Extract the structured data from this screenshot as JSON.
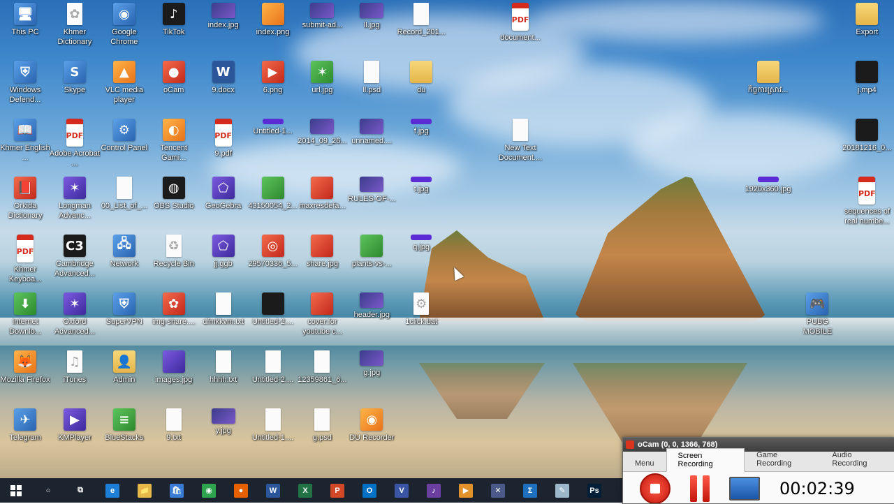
{
  "desktop": {
    "icons": [
      {
        "label": "This PC",
        "kind": "app",
        "glyph": "🖥"
      },
      {
        "label": "Khmer Dictionary",
        "kind": "file",
        "glyph": "✿"
      },
      {
        "label": "Google Chrome",
        "kind": "app",
        "glyph": "◉"
      },
      {
        "label": "TikTok",
        "kind": "dark",
        "glyph": "♪"
      },
      {
        "label": "index.jpg",
        "kind": "img",
        "glyph": ""
      },
      {
        "label": "index.png",
        "kind": "orange",
        "glyph": ""
      },
      {
        "label": "submit-ad...",
        "kind": "img",
        "glyph": ""
      },
      {
        "label": "ll.jpg",
        "kind": "img",
        "glyph": ""
      },
      {
        "label": "Record_201...",
        "kind": "file",
        "glyph": ""
      },
      {
        "label": "document...",
        "kind": "pdf",
        "glyph": "PDF"
      },
      {
        "label": "Export",
        "kind": "folder",
        "glyph": ""
      },
      {
        "label": "Windows Defend...",
        "kind": "app",
        "glyph": "⛨"
      },
      {
        "label": "Skype",
        "kind": "app",
        "glyph": "S"
      },
      {
        "label": "VLC media player",
        "kind": "orange",
        "glyph": "▲"
      },
      {
        "label": "oCam",
        "kind": "red",
        "glyph": "●"
      },
      {
        "label": "9.docx",
        "kind": "word",
        "glyph": "W"
      },
      {
        "label": "6.png",
        "kind": "red",
        "glyph": "▶"
      },
      {
        "label": "url.jpg",
        "kind": "green",
        "glyph": "✶"
      },
      {
        "label": "ll.psd",
        "kind": "file",
        "glyph": ""
      },
      {
        "label": "du",
        "kind": "folder",
        "glyph": ""
      },
      {
        "label": "កិច្ចការស្រាវ...",
        "kind": "folder",
        "glyph": ""
      },
      {
        "label": "j.mp4",
        "kind": "dark",
        "glyph": ""
      },
      {
        "label": "Khmer English ...",
        "kind": "app",
        "glyph": "📖"
      },
      {
        "label": "Adobe Acrobat ...",
        "kind": "pdf",
        "glyph": "PDF"
      },
      {
        "label": "Control Panel",
        "kind": "app",
        "glyph": "⚙"
      },
      {
        "label": "Tencent Gami...",
        "kind": "orange",
        "glyph": "◐"
      },
      {
        "label": "9.pdf",
        "kind": "pdf",
        "glyph": "PDF"
      },
      {
        "label": "Untitled-1...",
        "kind": "bar",
        "glyph": ""
      },
      {
        "label": "2014_09_26...",
        "kind": "img",
        "glyph": ""
      },
      {
        "label": "unnamed....",
        "kind": "img",
        "glyph": ""
      },
      {
        "label": "f.jpg",
        "kind": "bar",
        "glyph": ""
      },
      {
        "label": "New Text Document....",
        "kind": "file",
        "glyph": ""
      },
      {
        "label": "20181216_0...",
        "kind": "dark",
        "glyph": ""
      },
      {
        "label": "Orkida Dictionary",
        "kind": "red",
        "glyph": "📕"
      },
      {
        "label": "Longman Advanc...",
        "kind": "purple",
        "glyph": "✶"
      },
      {
        "label": "00_List_of_...",
        "kind": "file",
        "glyph": ""
      },
      {
        "label": "OBS Studio",
        "kind": "dark",
        "glyph": "◍"
      },
      {
        "label": "GeoGebra",
        "kind": "purple",
        "glyph": "⬠"
      },
      {
        "label": "43150054_2...",
        "kind": "green",
        "glyph": ""
      },
      {
        "label": "maxresdefa...",
        "kind": "red",
        "glyph": ""
      },
      {
        "label": "RULES-OF-...",
        "kind": "img",
        "glyph": ""
      },
      {
        "label": "t.jpg",
        "kind": "bar",
        "glyph": ""
      },
      {
        "label": "1920x360.jpg",
        "kind": "bar",
        "glyph": ""
      },
      {
        "label": "sequences of real numbe...",
        "kind": "pdf",
        "glyph": "PDF"
      },
      {
        "label": "Khmer Keyboa...",
        "kind": "pdf",
        "glyph": "PDF"
      },
      {
        "label": "Cambridge Advanced...",
        "kind": "dark",
        "glyph": "C3"
      },
      {
        "label": "Network",
        "kind": "app",
        "glyph": "🖧"
      },
      {
        "label": "Recycle Bin",
        "kind": "file",
        "glyph": "♻"
      },
      {
        "label": "jj.ggb",
        "kind": "purple",
        "glyph": "⬠"
      },
      {
        "label": "29570336_5...",
        "kind": "red",
        "glyph": "◎"
      },
      {
        "label": "share.jpg",
        "kind": "red",
        "glyph": ""
      },
      {
        "label": "plants-vs-...",
        "kind": "green",
        "glyph": ""
      },
      {
        "label": "q.jpg",
        "kind": "bar",
        "glyph": ""
      },
      {
        "label": "Internet Downlo...",
        "kind": "green",
        "glyph": "⬇"
      },
      {
        "label": "Oxford Advanced...",
        "kind": "purple",
        "glyph": "✶"
      },
      {
        "label": "SuperVPN",
        "kind": "app",
        "glyph": "⛨"
      },
      {
        "label": "img-share....",
        "kind": "red",
        "glyph": "✿"
      },
      {
        "label": "dfmkkvm.txt",
        "kind": "file",
        "glyph": ""
      },
      {
        "label": "Untitled-2....",
        "kind": "dark",
        "glyph": ""
      },
      {
        "label": "cover.for youtube c...",
        "kind": "red",
        "glyph": ""
      },
      {
        "label": "header.jpg",
        "kind": "img",
        "glyph": ""
      },
      {
        "label": "1click.bat",
        "kind": "file",
        "glyph": "⚙"
      },
      {
        "label": "PUBG MOBILE",
        "kind": "app",
        "glyph": "🎮"
      },
      {
        "label": "Mozilla Firefox",
        "kind": "orange",
        "glyph": "🦊"
      },
      {
        "label": "iTunes",
        "kind": "file",
        "glyph": "♫"
      },
      {
        "label": "Admin",
        "kind": "folder",
        "glyph": "👤"
      },
      {
        "label": "images.jpg",
        "kind": "purple",
        "glyph": ""
      },
      {
        "label": "hhhh.txt",
        "kind": "file",
        "glyph": ""
      },
      {
        "label": "Untitled-2....",
        "kind": "file",
        "glyph": ""
      },
      {
        "label": "12359861_6...",
        "kind": "file",
        "glyph": ""
      },
      {
        "label": "g.jpg",
        "kind": "img",
        "glyph": ""
      },
      {
        "label": "Telegram",
        "kind": "app",
        "glyph": "✈"
      },
      {
        "label": "KMPlayer",
        "kind": "purple",
        "glyph": "▶"
      },
      {
        "label": "BlueStacks",
        "kind": "green",
        "glyph": "≡"
      },
      {
        "label": "9.txt",
        "kind": "file",
        "glyph": ""
      },
      {
        "label": "y.jpg",
        "kind": "img",
        "glyph": ""
      },
      {
        "label": "Untitled-1....",
        "kind": "file",
        "glyph": ""
      },
      {
        "label": "g.psd",
        "kind": "file",
        "glyph": ""
      },
      {
        "label": "DU Recorder",
        "kind": "orange",
        "glyph": "◉"
      }
    ]
  },
  "taskbar": {
    "start_icon": "windows-start-icon",
    "items": [
      {
        "name": "cortana-search",
        "glyph": "○",
        "color": "transparent"
      },
      {
        "name": "task-view",
        "glyph": "⧉",
        "color": "transparent"
      },
      {
        "name": "edge",
        "glyph": "e",
        "color": "#1e7fd6"
      },
      {
        "name": "file-explorer",
        "glyph": "📁",
        "color": "#e6b84a"
      },
      {
        "name": "store",
        "glyph": "🛍",
        "color": "#3a7bd5"
      },
      {
        "name": "chrome",
        "glyph": "◉",
        "color": "#2ea44f"
      },
      {
        "name": "firefox",
        "glyph": "●",
        "color": "#e66000"
      },
      {
        "name": "word",
        "glyph": "W",
        "color": "#2b579a"
      },
      {
        "name": "excel",
        "glyph": "X",
        "color": "#217346"
      },
      {
        "name": "powerpoint",
        "glyph": "P",
        "color": "#d24726"
      },
      {
        "name": "outlook",
        "glyph": "O",
        "color": "#0072c6"
      },
      {
        "name": "visio",
        "glyph": "V",
        "color": "#3955a3"
      },
      {
        "name": "app-purple",
        "glyph": "♪",
        "color": "#6b3fa0"
      },
      {
        "name": "media-player",
        "glyph": "▶",
        "color": "#e2912b"
      },
      {
        "name": "app-network",
        "glyph": "✕",
        "color": "#4b5a8a"
      },
      {
        "name": "app-sigma",
        "glyph": "Σ",
        "color": "#1f6fbf"
      },
      {
        "name": "app-pen",
        "glyph": "✎",
        "color": "#9bb7c9"
      },
      {
        "name": "photoshop",
        "glyph": "Ps",
        "color": "#001e36"
      }
    ]
  },
  "ocam": {
    "title": "oCam (0, 0, 1366, 768)",
    "tabs": [
      "Menu",
      "Screen Recording",
      "Game Recording",
      "Audio Recording"
    ],
    "active_tab": "Screen Recording",
    "timer": "00:02:39"
  }
}
